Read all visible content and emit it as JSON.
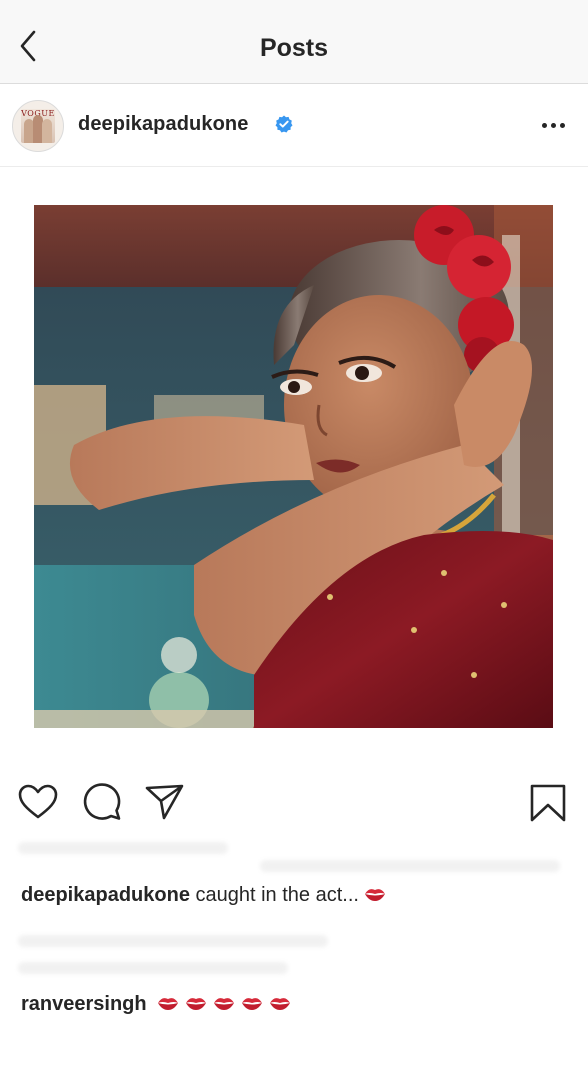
{
  "header": {
    "title": "Posts",
    "back_icon": "chevron-left-icon"
  },
  "post": {
    "username": "deepikapadukone",
    "verified": true,
    "avatar_text": "VOGUE",
    "more_icon": "more-horizontal-icon",
    "image_alt": "Woman in maroon velvet outfit with red roses in her hair, arms raised behind her head",
    "actions": {
      "like_icon": "heart-icon",
      "comment_icon": "comment-icon",
      "share_icon": "send-icon",
      "save_icon": "bookmark-icon"
    },
    "caption": {
      "username": "deepikapadukone",
      "text": "caught in the act...",
      "emoji_count": 1
    },
    "comment": {
      "username": "ranveersingh",
      "emoji_count": 5
    }
  },
  "colors": {
    "accent_blue": "#3897f0",
    "text": "#262626",
    "kiss_red": "#d62a3a"
  }
}
